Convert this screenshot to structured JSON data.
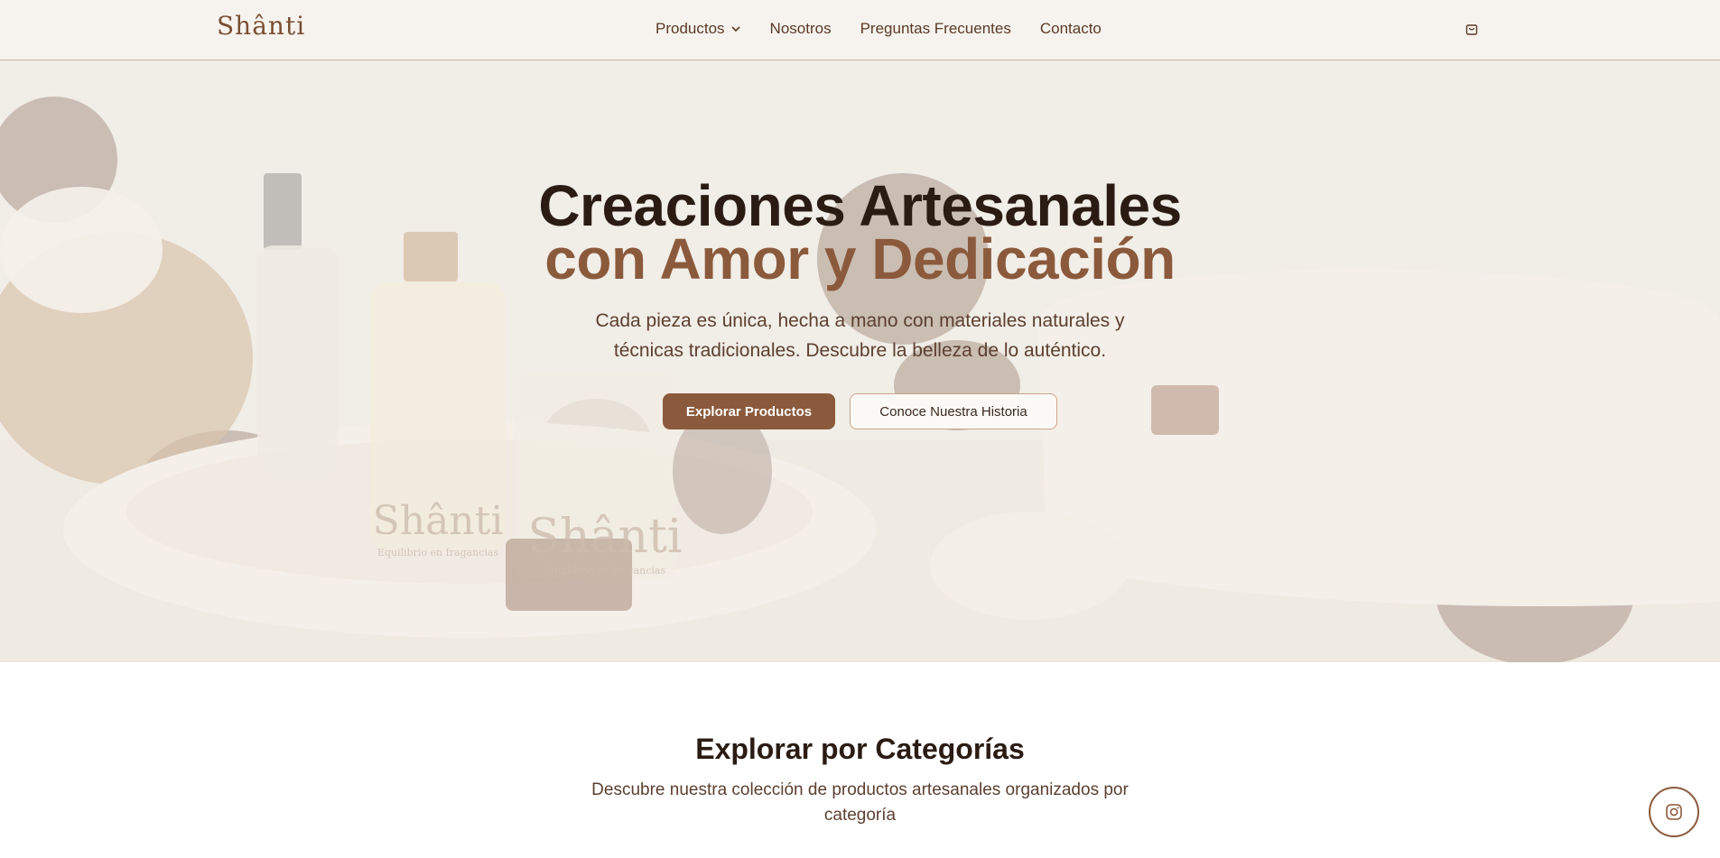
{
  "brand": {
    "logo": "Shânti"
  },
  "nav": {
    "items": [
      {
        "label": "Productos",
        "has_dropdown": true
      },
      {
        "label": "Nosotros"
      },
      {
        "label": "Preguntas Frecuentes"
      },
      {
        "label": "Contacto"
      }
    ],
    "cart_icon": "shopping-bag-icon"
  },
  "hero": {
    "title_line1": "Creaciones Artesanales",
    "title_line2": "con Amor y Dedicación",
    "subtitle": "Cada pieza es única, hecha a mano con materiales naturales y técnicas tradicionales. Descubre la belleza de lo auténtico.",
    "primary_button": "Explorar Productos",
    "secondary_button": "Conoce Nuestra Historia",
    "photo_bottle_labels": [
      "Shânti",
      "Shânti"
    ],
    "photo_bottle_sublabels": [
      "Equilibrio en fragancias",
      "Equilibrio en fragancias"
    ]
  },
  "categories": {
    "title": "Explorar por Categorías",
    "subtitle": "Descubre nuestra colección de productos artesanales organizados por categoría"
  },
  "floating": {
    "instagram_icon": "instagram-icon"
  },
  "colors": {
    "accent": "#8b5a3c",
    "dark_text": "#2b1c13",
    "nav_bg": "#f6f3ee"
  }
}
